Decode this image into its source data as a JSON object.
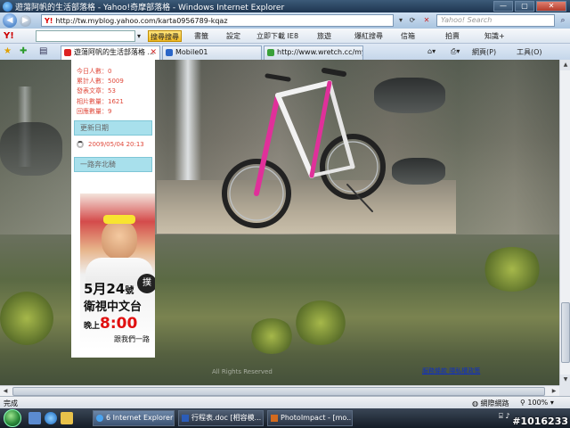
{
  "window": {
    "title": "遊蕩阿帆的生活部落格 - Yahoo!奇摩部落格 - Windows Internet Explorer"
  },
  "address_bar": {
    "url": "http://tw.myblog.yahoo.com/karta0956789-kqaz",
    "search_placeholder": "Yahoo! Search"
  },
  "yahoo_toolbar": {
    "logo": "Y!",
    "search_button": "搜尋搜尋",
    "items": [
      "書籤",
      "設定",
      "立即下載 IE8",
      "旅遊",
      "爆紅搜尋",
      "信箱",
      "拍賣",
      "知識+"
    ]
  },
  "tabs": [
    {
      "label": "遊蕩阿帆的生活部落格 ...",
      "active": true
    },
    {
      "label": "Mobile01",
      "active": false
    },
    {
      "label": "http://www.wretch.cc/my...",
      "active": false
    }
  ],
  "commands": {
    "page": "網頁(P)",
    "tools": "工具(O)"
  },
  "sidebar": {
    "stats": [
      "今日人數：0",
      "累計人數：5009",
      "發表文章：53",
      "相片數量：1621",
      "回應數量：9"
    ],
    "update_header": "更新日期",
    "update_date": "2009/05/04 20:13",
    "promo_header": "一路奔北騎",
    "promo": {
      "date_line_num": "5月24",
      "date_line_suffix": "號",
      "channel": "衛視中文台",
      "time_prefix": "晚上",
      "time": "8:00",
      "tagline": "跟我們一路",
      "seal": "撲"
    }
  },
  "footer": {
    "copyright": "All Rights Reserved",
    "links": "服務條款  隱私權政策"
  },
  "status_bar": {
    "status": "完成",
    "zone": "網際網路",
    "zoom": "100%"
  },
  "taskbar": {
    "tasks": [
      {
        "label": "6 Internet Explorer",
        "active": true
      },
      {
        "label": "行程表.doc [相容模...",
        "active": false
      },
      {
        "label": "PhotoImpact - [mo...",
        "active": false
      }
    ]
  },
  "watermark": "#1016233"
}
